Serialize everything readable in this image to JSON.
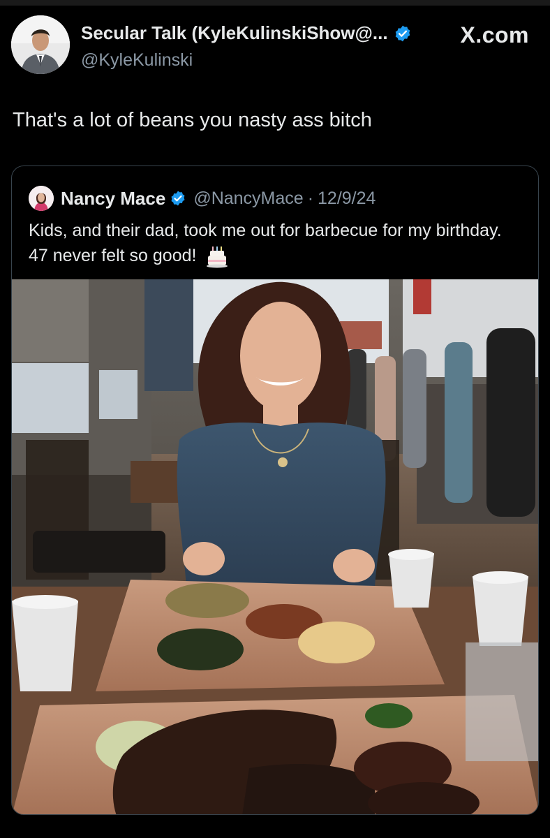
{
  "author": {
    "display_name": "Secular Talk (KyleKulinskiShow@...",
    "handle": "@KyleKulinski",
    "verified": true,
    "avatar_icon": "profile-photo-avatar"
  },
  "site_label": "X.com",
  "tweet": {
    "text": "That's a lot of beans you nasty ass bitch"
  },
  "quoted_tweet": {
    "display_name": "Nancy Mace",
    "handle": "@NancyMace",
    "separator": "·",
    "date": "12/9/24",
    "verified": true,
    "text": "Kids, and their dad, took me out for barbecue for my birthday. 47 never felt so good!",
    "emoji_icon": "birthday-cake-icon"
  },
  "colors": {
    "background": "#000000",
    "text_primary": "#e7e9ea",
    "text_secondary": "#8b98a5",
    "verified_blue": "#1d9bf0",
    "border": "#38444d"
  }
}
